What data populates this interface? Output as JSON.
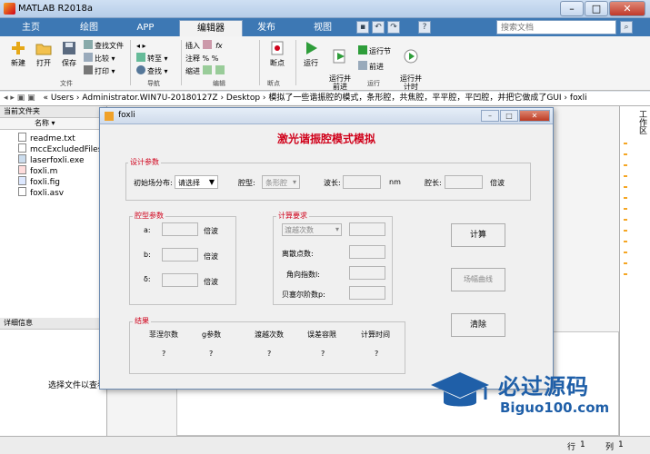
{
  "window": {
    "title": "MATLAB R2018a",
    "minimize": "–",
    "maximize": "□",
    "close": "✕"
  },
  "tabs": [
    {
      "label": "主页"
    },
    {
      "label": "绘图"
    },
    {
      "label": "APP"
    },
    {
      "label": "编辑器"
    },
    {
      "label": "发布"
    },
    {
      "label": "视图"
    }
  ],
  "search": {
    "placeholder": "搜索文档"
  },
  "ribbon": {
    "file": {
      "new": "新建",
      "open": "打开",
      "save": "保存",
      "find_file": "查找文件",
      "compare": "比较",
      "print": "打印",
      "group": "文件"
    },
    "navigate": {
      "goto": "转至",
      "find": "查找",
      "group": "导航"
    },
    "edit": {
      "insert": "插入",
      "comment": "注释",
      "indent": "缩进",
      "fx": "fx",
      "group": "编辑"
    },
    "breakpoints": {
      "label": "断点",
      "group": "断点"
    },
    "run": {
      "run": "运行",
      "run_advance": "运行并\n前进",
      "run_section": "运行节",
      "advance": "前进",
      "run_time": "运行并\n计时",
      "group": "运行"
    }
  },
  "address": {
    "path": "« Users › Administrator.WIN7U-20180127Z › Desktop › 模拟了一些谐振腔的模式，条形腔，共焦腔，平平腔，平凹腔，并把它做成了GUI › foxli"
  },
  "current_folder": {
    "header": "当前文件夹",
    "column": "名称",
    "files": [
      {
        "name": "readme.txt"
      },
      {
        "name": "mccExcludedFiles.log"
      },
      {
        "name": "laserfoxli.exe"
      },
      {
        "name": "foxli.m"
      },
      {
        "name": "foxli.fig"
      },
      {
        "name": "foxli.asv"
      }
    ],
    "details_header": "详细信息",
    "details_hint": "选择文件以查看"
  },
  "workspace_label": "工作区",
  "status": {
    "row_label": "行",
    "row": "1",
    "col_label": "列",
    "col": "1"
  },
  "dialog": {
    "title": "foxli",
    "heading": "激光谐振腔模式模拟",
    "design": {
      "legend": "设计参数",
      "initial_dist_label": "初始场分布:",
      "initial_dist_value": "请选择",
      "cavity_type_label": "腔型:",
      "cavity_type_value": "条形腔",
      "wavelength_label": "波长:",
      "wavelength_unit": "nm",
      "cavity_length_label": "腔长:",
      "cavity_length_unit": "倍波"
    },
    "cavity_params": {
      "legend": "腔型参数",
      "a_label": "a:",
      "b_label": "b:",
      "delta_label": "δ:",
      "unit": "倍波"
    },
    "calc": {
      "legend": "计算要求",
      "iterations_value": "渡越次数",
      "discrete_points": "离散点数:",
      "angular_index": "角向指数l:",
      "bessel_order": "贝塞尔阶数p:"
    },
    "buttons": {
      "compute": "计算",
      "plot": "场幅曲线",
      "clear": "清除"
    },
    "results": {
      "legend": "结果",
      "columns": [
        "菲涅尔数",
        "g参数",
        "渡越次数",
        "误差容限",
        "计算时间"
      ],
      "values": [
        "?",
        "?",
        "?",
        "?",
        "?"
      ]
    }
  },
  "watermark": {
    "cn": "必过源码",
    "en": "Biguo100.com"
  },
  "colors": {
    "tab_strip": "#3d78b4",
    "heading_red": "#d0021b",
    "watermark_blue": "#1f5fa8"
  }
}
